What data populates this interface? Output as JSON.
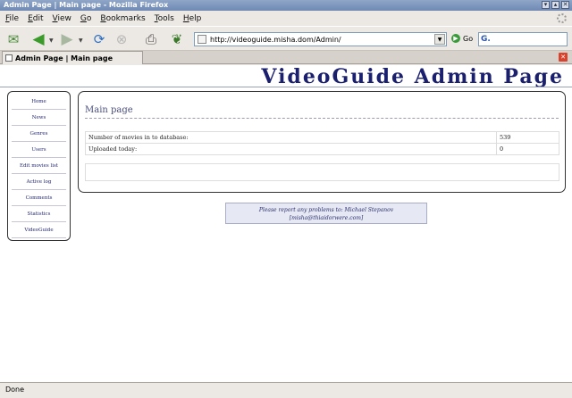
{
  "window": {
    "title": "Admin Page | Main page - Mozilla Firefox",
    "buttons": [
      "▾",
      "▴",
      "✕"
    ]
  },
  "menu": [
    "File",
    "Edit",
    "View",
    "Go",
    "Bookmarks",
    "Tools",
    "Help"
  ],
  "toolbar": {
    "icons": [
      "get-mail-icon",
      "back-icon",
      "forward-icon",
      "reload-icon",
      "stop-icon",
      "print-icon",
      "leaf-icon"
    ],
    "url": "http://videoguide.misha.dom/Admin/",
    "go_label": "Go",
    "search_logo": "G."
  },
  "tab": {
    "label": "Admin Page | Main page"
  },
  "site": {
    "title": "VideoGuide Admin Page",
    "nav": [
      "Home",
      "News",
      "Genres",
      "Users",
      "Edit movies list",
      "Active log",
      "Comments",
      "Statistics",
      "VideoGuide"
    ]
  },
  "main": {
    "title": "Main page",
    "rows": [
      {
        "label": "Number of movies in to database:",
        "value": "539"
      },
      {
        "label": "Uploaded today:",
        "value": "0"
      }
    ]
  },
  "footer": {
    "line1": "Please report any problems to: Michael Stepanov",
    "line2": "[misha@thiaidorwere.com]"
  },
  "status": {
    "text": "Done"
  },
  "colors": {
    "brand": "#1a1f6e",
    "titlebar": "#7790b8"
  }
}
